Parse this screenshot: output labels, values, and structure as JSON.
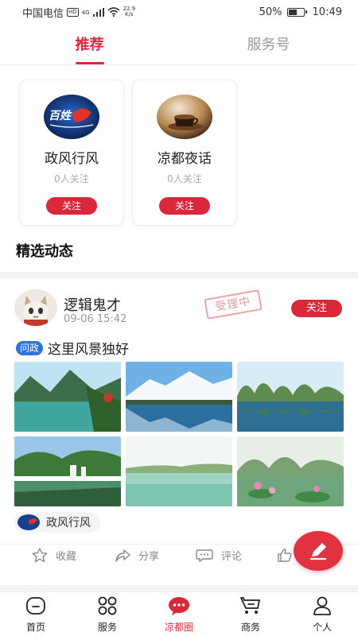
{
  "status_bar": {
    "carrier": "中国电信",
    "hd": "HD",
    "network": "4G",
    "speed_value": "22.9",
    "speed_unit": "K/s",
    "battery": "50%",
    "battery_level": 0.5,
    "time": "10:49"
  },
  "tabs": [
    {
      "label": "推荐",
      "active": true
    },
    {
      "label": "服务号",
      "active": false
    }
  ],
  "accounts": [
    {
      "name": "政风行风",
      "followers": "0人关注",
      "follow_label": "关注"
    },
    {
      "name": "凉都夜话",
      "followers": "0人关注",
      "follow_label": "关注"
    }
  ],
  "logo_text": "百姓",
  "section_title": "精选动态",
  "post": {
    "author": "逻辑鬼才",
    "time": "09-06 15:42",
    "stamp": "受理中",
    "follow_label": "关注",
    "tag": "问政",
    "text": "这里风景独好",
    "channel": "政风行风",
    "actions": {
      "collect": "收藏",
      "share": "分享",
      "comment": "评论"
    }
  },
  "bottom_nav": [
    {
      "label": "首页",
      "icon": "home-icon",
      "active": false
    },
    {
      "label": "服务",
      "icon": "grid-icon",
      "active": false
    },
    {
      "label": "凉都圈",
      "icon": "chat-bubble-icon",
      "active": true
    },
    {
      "label": "商务",
      "icon": "cart-icon",
      "active": false
    },
    {
      "label": "个人",
      "icon": "person-icon",
      "active": false
    }
  ],
  "colors": {
    "accent": "#d8283a",
    "tag_blue": "#2f6fe0",
    "muted": "#999999"
  }
}
